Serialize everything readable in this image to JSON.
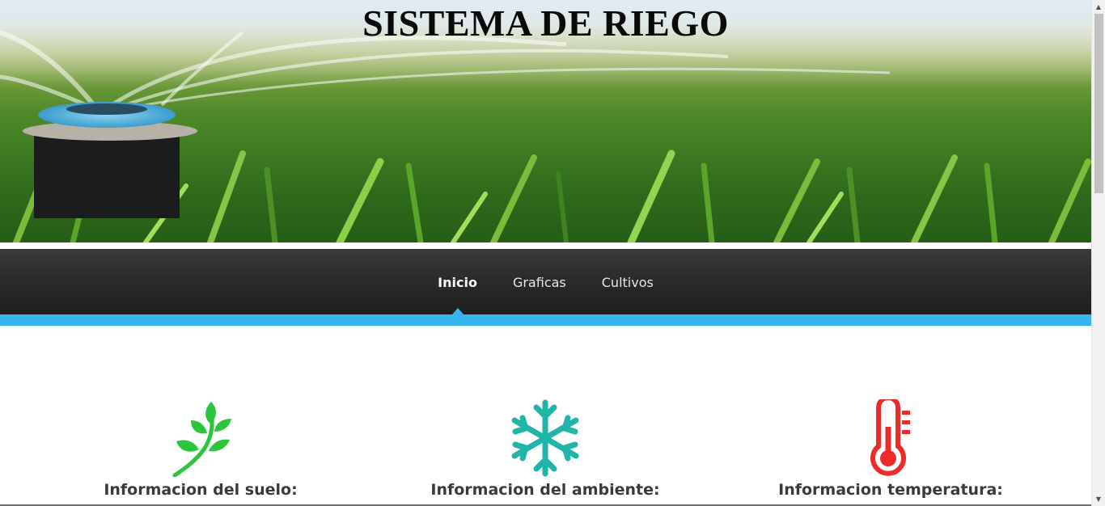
{
  "banner": {
    "title": "SISTEMA DE RIEGO"
  },
  "nav": {
    "items": [
      {
        "label": "Inicio",
        "active": true
      },
      {
        "label": "Graficas",
        "active": false
      },
      {
        "label": "Cultivos",
        "active": false
      }
    ],
    "accent_color": "#37b6ee"
  },
  "features": [
    {
      "title": "Informacion del suelo:",
      "icon": "leaf-icon",
      "color": "#2cc63c"
    },
    {
      "title": "Informacion del ambiente:",
      "icon": "snowflake-icon",
      "color": "#1fb5a8"
    },
    {
      "title": "Informacion temperatura:",
      "icon": "thermometer-icon",
      "color": "#ee2b2b"
    }
  ]
}
